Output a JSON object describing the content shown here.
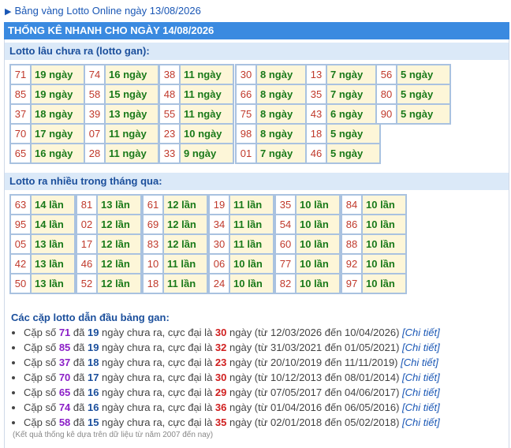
{
  "header": {
    "link_text": "Bảng vàng Lotto Online ngày 13/08/2026",
    "title": "THỐNG KÊ NHANH CHO NGÀY 14/08/2026"
  },
  "gan": {
    "heading": "Lotto lâu chưa ra (lotto gan):",
    "columns": [
      [
        [
          "71",
          "19 ngày"
        ],
        [
          "85",
          "19 ngày"
        ],
        [
          "37",
          "18 ngày"
        ],
        [
          "70",
          "17 ngày"
        ],
        [
          "65",
          "16 ngày"
        ]
      ],
      [
        [
          "74",
          "16 ngày"
        ],
        [
          "58",
          "15 ngày"
        ],
        [
          "39",
          "13 ngày"
        ],
        [
          "07",
          "11 ngày"
        ],
        [
          "28",
          "11 ngày"
        ]
      ],
      [
        [
          "38",
          "11 ngày"
        ],
        [
          "48",
          "11 ngày"
        ],
        [
          "55",
          "11 ngày"
        ],
        [
          "23",
          "10 ngày"
        ],
        [
          "33",
          "9 ngày"
        ]
      ],
      [
        [
          "30",
          "8 ngày"
        ],
        [
          "66",
          "8 ngày"
        ],
        [
          "75",
          "8 ngày"
        ],
        [
          "98",
          "8 ngày"
        ],
        [
          "01",
          "7 ngày"
        ]
      ],
      [
        [
          "13",
          "7 ngày"
        ],
        [
          "35",
          "7 ngày"
        ],
        [
          "43",
          "6 ngày"
        ],
        [
          "18",
          "5 ngày"
        ],
        [
          "46",
          "5 ngày"
        ]
      ],
      [
        [
          "56",
          "5 ngày"
        ],
        [
          "80",
          "5 ngày"
        ],
        [
          "90",
          "5 ngày"
        ]
      ]
    ]
  },
  "freq": {
    "heading": "Lotto ra nhiều trong tháng qua:",
    "columns": [
      [
        [
          "63",
          "14 lần"
        ],
        [
          "95",
          "14 lần"
        ],
        [
          "05",
          "13 lần"
        ],
        [
          "42",
          "13 lần"
        ],
        [
          "50",
          "13 lần"
        ]
      ],
      [
        [
          "81",
          "13 lần"
        ],
        [
          "02",
          "12 lần"
        ],
        [
          "17",
          "12 lần"
        ],
        [
          "46",
          "12 lần"
        ],
        [
          "52",
          "12 lần"
        ]
      ],
      [
        [
          "61",
          "12 lần"
        ],
        [
          "69",
          "12 lần"
        ],
        [
          "83",
          "12 lần"
        ],
        [
          "10",
          "11 lần"
        ],
        [
          "18",
          "11 lần"
        ]
      ],
      [
        [
          "19",
          "11 lần"
        ],
        [
          "34",
          "11 lần"
        ],
        [
          "30",
          "11 lần"
        ],
        [
          "06",
          "10 lần"
        ],
        [
          "24",
          "10 lần"
        ]
      ],
      [
        [
          "35",
          "10 lần"
        ],
        [
          "54",
          "10 lần"
        ],
        [
          "60",
          "10 lần"
        ],
        [
          "77",
          "10 lần"
        ],
        [
          "82",
          "10 lần"
        ]
      ],
      [
        [
          "84",
          "10 lần"
        ],
        [
          "86",
          "10 lần"
        ],
        [
          "88",
          "10 lần"
        ],
        [
          "92",
          "10 lần"
        ],
        [
          "97",
          "10 lần"
        ]
      ]
    ]
  },
  "pairs": {
    "heading": "Các cặp lotto dẫn đầu bảng gan:",
    "prefix": "Cặp số",
    "da": "đã",
    "mid": "ngày chưa ra, cực đại là",
    "suffix_ngay": "ngày",
    "link": "[Chi tiết]",
    "items": [
      {
        "num": "71",
        "days": "19",
        "max": "30",
        "range": "(từ 12/03/2026 đến 10/04/2026)"
      },
      {
        "num": "85",
        "days": "19",
        "max": "32",
        "range": "(từ 31/03/2021 đến 01/05/2021)"
      },
      {
        "num": "37",
        "days": "18",
        "max": "23",
        "range": "(từ 20/10/2019 đến 11/11/2019)"
      },
      {
        "num": "70",
        "days": "17",
        "max": "30",
        "range": "(từ 10/12/2013 đến 08/01/2014)"
      },
      {
        "num": "65",
        "days": "16",
        "max": "29",
        "range": "(từ 07/05/2017 đến 04/06/2017)"
      },
      {
        "num": "74",
        "days": "16",
        "max": "36",
        "range": "(từ 01/04/2016 đến 06/05/2016)"
      },
      {
        "num": "58",
        "days": "15",
        "max": "35",
        "range": "(từ 02/01/2018 đến 05/02/2018)"
      }
    ]
  },
  "note": "(Kết quả thống kê dựa trên dữ liệu từ năm 2007 đến nay)"
}
